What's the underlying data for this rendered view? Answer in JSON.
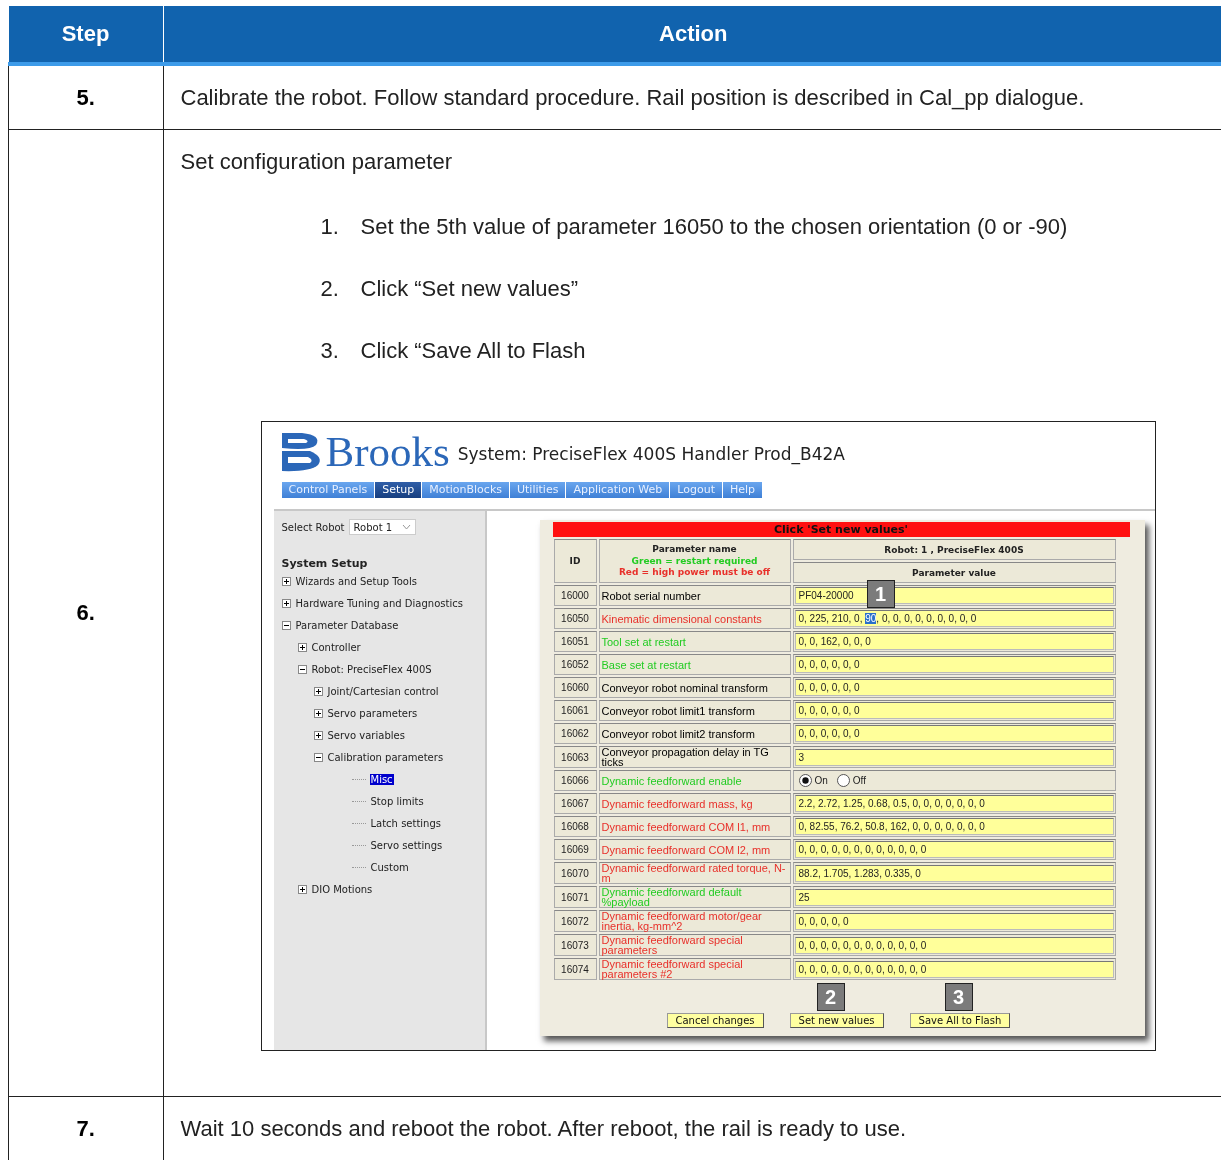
{
  "table": {
    "columns": [
      "Step",
      "Action"
    ],
    "rows": [
      {
        "kind": "text",
        "step": "5.",
        "text": "Calibrate the robot. Follow standard procedure. Rail position is described in Cal_pp dialogue."
      },
      {
        "kind": "procedure",
        "step": "6.",
        "intro": "Set configuration parameter",
        "steps": [
          {
            "number": "1.",
            "text": "Set the 5th value of parameter 16050 to the chosen orientation (0 or -90)"
          },
          {
            "number": "2.",
            "text": "Click “Set new values”"
          },
          {
            "number": "3.",
            "text": "Click “Save All to Flash"
          }
        ],
        "screenshot": {
          "logo": "Brooks",
          "title": "System: PreciseFlex 400S Handler Prod_B42A",
          "nav": [
            {
              "label": "Control Panels",
              "selected": false
            },
            {
              "label": "Setup",
              "selected": true
            },
            {
              "label": "MotionBlocks",
              "selected": false
            },
            {
              "label": "Utilities",
              "selected": false
            },
            {
              "label": "Application Web",
              "selected": false
            },
            {
              "label": "Logout",
              "selected": false
            },
            {
              "label": "Help",
              "selected": false
            }
          ],
          "select_robot": {
            "label": "Select Robot",
            "value": "Robot 1"
          },
          "tree": {
            "title": "System Setup",
            "items": [
              {
                "label": "Wizards and Setup Tools",
                "kind": "folder",
                "expanded": false,
                "selected": false
              },
              {
                "label": "Hardware Tuning and Diagnostics",
                "kind": "folder",
                "expanded": false,
                "selected": false
              },
              {
                "label": "Parameter Database",
                "kind": "folder",
                "expanded": true,
                "selected": false,
                "children": [
                  {
                    "label": "Controller",
                    "kind": "folder",
                    "expanded": false,
                    "selected": false
                  },
                  {
                    "label": "Robot: PreciseFlex 400S",
                    "kind": "folder",
                    "expanded": true,
                    "selected": false,
                    "children": [
                      {
                        "label": "Joint/Cartesian control",
                        "kind": "folder",
                        "expanded": false,
                        "selected": false
                      },
                      {
                        "label": "Servo parameters",
                        "kind": "folder",
                        "expanded": false,
                        "selected": false
                      },
                      {
                        "label": "Servo variables",
                        "kind": "folder",
                        "expanded": false,
                        "selected": false
                      },
                      {
                        "label": "Calibration parameters",
                        "kind": "folder",
                        "expanded": true,
                        "selected": false,
                        "children": [
                          {
                            "label": "Misc",
                            "kind": "leaf",
                            "selected": true
                          },
                          {
                            "label": "Stop limits",
                            "kind": "leaf",
                            "selected": false
                          },
                          {
                            "label": "Latch settings",
                            "kind": "leaf",
                            "selected": false
                          },
                          {
                            "label": "Servo settings",
                            "kind": "leaf",
                            "selected": false
                          },
                          {
                            "label": "Custom",
                            "kind": "leaf",
                            "selected": false
                          }
                        ]
                      }
                    ]
                  },
                  {
                    "label": "DIO Motions",
                    "kind": "folder",
                    "expanded": false,
                    "selected": false
                  }
                ]
              }
            ]
          },
          "banner": "Click 'Set new values'",
          "params": {
            "id_header": "ID",
            "name_header": "Parameter name",
            "legend": [
              {
                "text": "Green = restart required",
                "color": "#22cc22"
              },
              {
                "text": "Red = high power must be off",
                "color": "#e8302a"
              }
            ],
            "robot_header": "Robot: 1 , PreciseFlex 400S",
            "value_header": "Parameter value",
            "rows": [
              {
                "id": "16000",
                "name": "Robot serial number",
                "color": "#000000",
                "kind": "field",
                "value": "PF04-20000"
              },
              {
                "id": "16050",
                "name": "Kinematic dimensional constants",
                "color": "#e8302a",
                "kind": "field",
                "segments": [
                  {
                    "text": "0, 225, 210, 0, ",
                    "selected": false
                  },
                  {
                    "text": "90",
                    "selected": true
                  },
                  {
                    "text": ", 0, 0, 0, 0, 0, 0, 0, 0, 0",
                    "selected": false
                  }
                ]
              },
              {
                "id": "16051",
                "name": "Tool set at restart",
                "color": "#22cc22",
                "kind": "field",
                "value": "0, 0, 162, 0, 0, 0"
              },
              {
                "id": "16052",
                "name": "Base set at restart",
                "color": "#22cc22",
                "kind": "field",
                "value": "0, 0, 0, 0, 0, 0"
              },
              {
                "id": "16060",
                "name": "Conveyor robot nominal transform",
                "color": "#000000",
                "kind": "field",
                "value": "0, 0, 0, 0, 0, 0"
              },
              {
                "id": "16061",
                "name": "Conveyor robot limit1 transform",
                "color": "#000000",
                "kind": "field",
                "value": "0, 0, 0, 0, 0, 0"
              },
              {
                "id": "16062",
                "name": "Conveyor robot limit2 transform",
                "color": "#000000",
                "kind": "field",
                "value": "0, 0, 0, 0, 0, 0"
              },
              {
                "id": "16063",
                "name": "Conveyor propagation delay in TG ticks",
                "color": "#000000",
                "kind": "field",
                "value": "3"
              },
              {
                "id": "16066",
                "name": "Dynamic feedforward enable",
                "color": "#22cc22",
                "kind": "radio",
                "options": [
                  {
                    "label": "On",
                    "selected": true
                  },
                  {
                    "label": "Off",
                    "selected": false
                  }
                ]
              },
              {
                "id": "16067",
                "name": "Dynamic feedforward mass, kg",
                "color": "#e8302a",
                "kind": "field",
                "value": "2.2, 2.72, 1.25, 0.68, 0.5, 0, 0, 0, 0, 0, 0, 0"
              },
              {
                "id": "16068",
                "name": "Dynamic feedforward COM l1, mm",
                "color": "#e8302a",
                "kind": "field",
                "value": "0, 82.55, 76.2, 50.8, 162, 0, 0, 0, 0, 0, 0, 0"
              },
              {
                "id": "16069",
                "name": "Dynamic feedforward COM l2, mm",
                "color": "#e8302a",
                "kind": "field",
                "value": "0, 0, 0, 0, 0, 0, 0, 0, 0, 0, 0, 0"
              },
              {
                "id": "16070",
                "name": "Dynamic feedforward rated torque, N-m",
                "color": "#e8302a",
                "kind": "field",
                "value": "88.2, 1.705, 1.283, 0.335, 0"
              },
              {
                "id": "16071",
                "name": "Dynamic feedforward default %payload",
                "color": "#22cc22",
                "kind": "field",
                "value": "25"
              },
              {
                "id": "16072",
                "name": "Dynamic feedforward motor/gear inertia, kg-mm^2",
                "color": "#e8302a",
                "kind": "field",
                "value": "0, 0, 0, 0, 0"
              },
              {
                "id": "16073",
                "name": "Dynamic feedforward special parameters",
                "color": "#e8302a",
                "kind": "field",
                "value": "0, 0, 0, 0, 0, 0, 0, 0, 0, 0, 0, 0"
              },
              {
                "id": "16074",
                "name": "Dynamic feedforward special parameters #2",
                "color": "#e8302a",
                "kind": "field",
                "value": "0, 0, 0, 0, 0, 0, 0, 0, 0, 0, 0, 0"
              }
            ]
          },
          "buttons": [
            "Cancel changes",
            "Set new values",
            "Save All to Flash"
          ],
          "badges": [
            "1",
            "2",
            "3"
          ]
        }
      },
      {
        "kind": "text",
        "step": "7.",
        "text": "Wait 10 seconds and reboot the robot. After reboot, the rail is ready to use."
      }
    ]
  }
}
